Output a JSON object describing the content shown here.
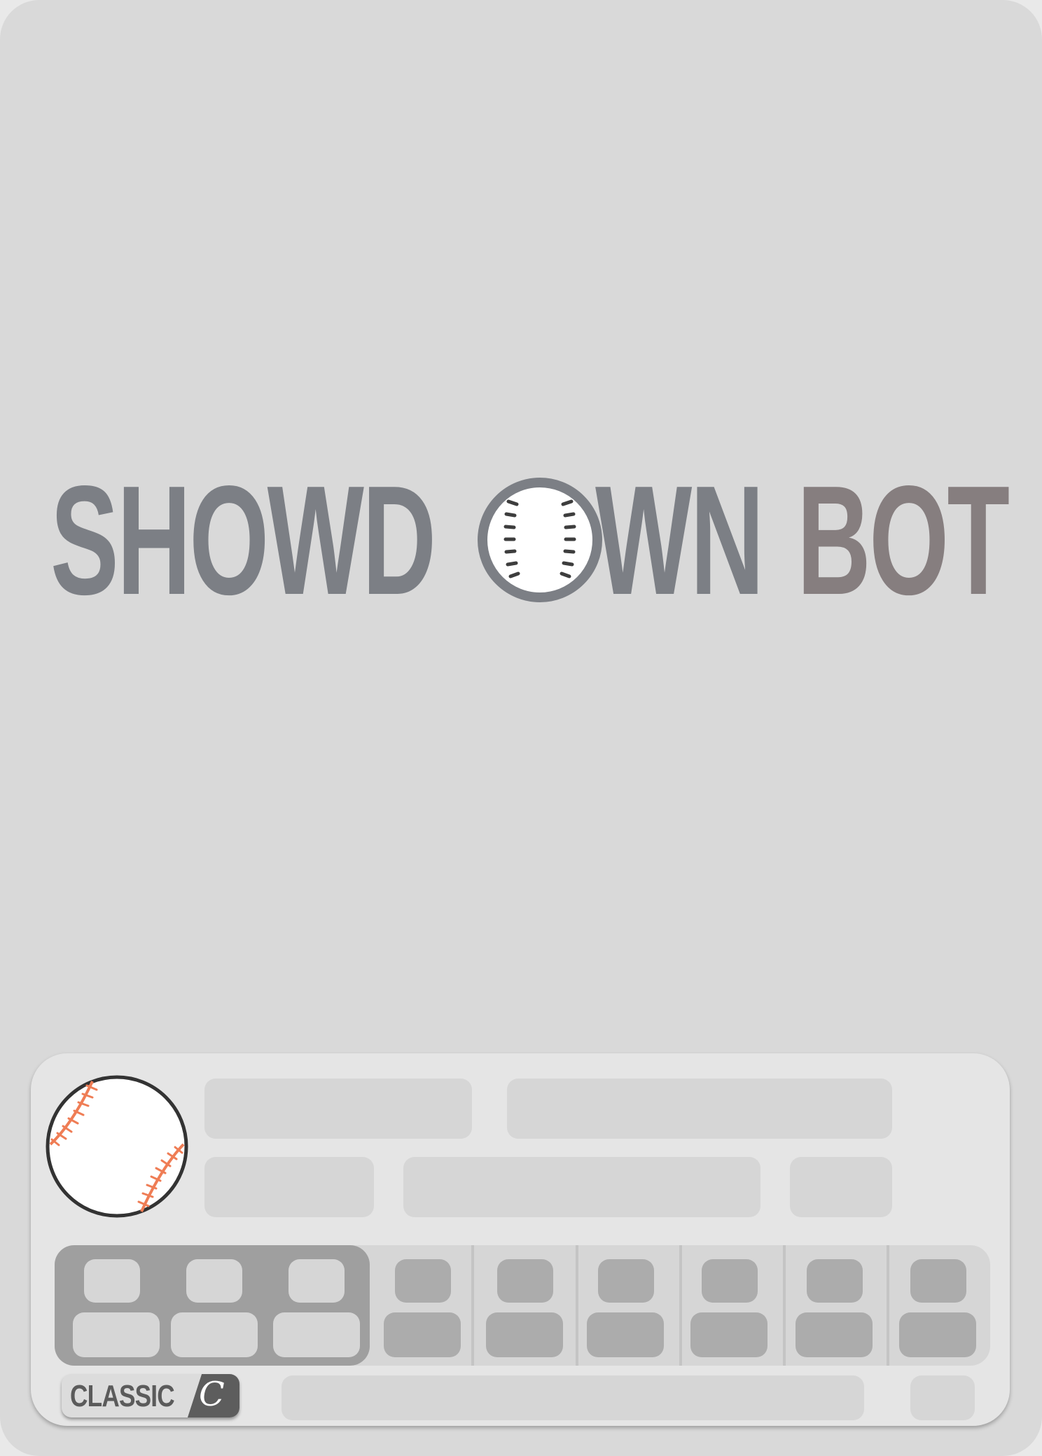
{
  "logo": {
    "text_main": "SHOWD",
    "text_after_ball": "WN",
    "text_accent": "BOT",
    "ball_icon": "baseball-icon",
    "main_color": "#7c7f85",
    "accent_color": "#867e7f"
  },
  "footer": {
    "badge_label": "CLASSIC",
    "badge_mark": "C",
    "avatar_icon": "baseball-icon"
  },
  "colors": {
    "card_background": "#d9d9d9",
    "panel_background": "#e5e5e5",
    "placeholder": "#d6d6d6",
    "stats_dark": "#9f9f9f",
    "ball_seams": "#ef7d55"
  }
}
